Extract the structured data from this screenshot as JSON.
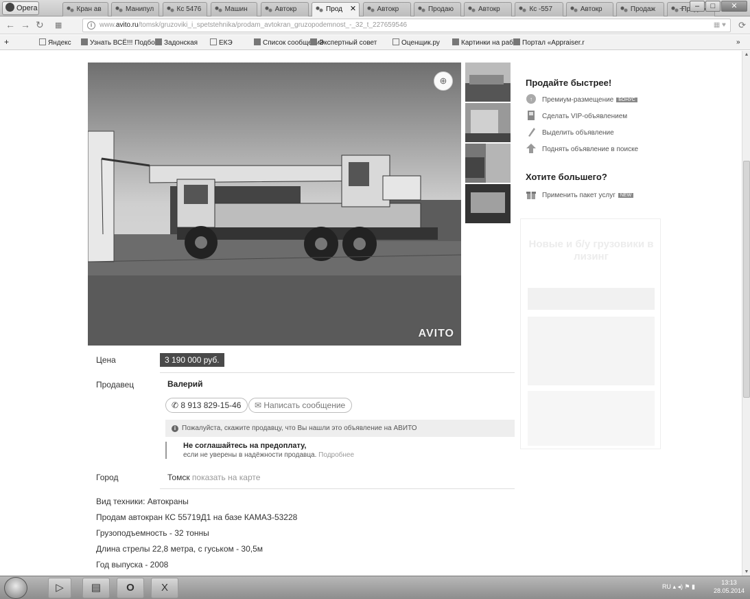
{
  "browser": {
    "menu_label": "Opera",
    "tabs": [
      {
        "label": "Кран ав"
      },
      {
        "label": "Манипул"
      },
      {
        "label": "Кс 5476"
      },
      {
        "label": "Машин"
      },
      {
        "label": "Автокр"
      },
      {
        "label": "Прод",
        "active": true
      },
      {
        "label": "Автокр"
      },
      {
        "label": "Продаю"
      },
      {
        "label": "Автокр"
      },
      {
        "label": "Кс -557"
      },
      {
        "label": "Автокр"
      },
      {
        "label": "Продаж"
      },
      {
        "label": "Продаж"
      }
    ],
    "url_prefix": "www.",
    "url_host": "avito.ru",
    "url_path": "/tomsk/gruzoviki_i_spetstehnika/prodam_avtokran_gruzopodemnost_-_32_t_227659546",
    "bookmarks": [
      "Яндекс",
      "Узнать ВСЁ!!! Подбо",
      "Задонская",
      "ЕКЭ",
      "Список сообщений",
      "Экспертный совет",
      "Оценщик.ру",
      "Картинки на рабоч",
      "Портал «Appraiser.r"
    ],
    "more_bookmarks": "»"
  },
  "listing": {
    "price_label": "Цена",
    "price": "3 190 000 руб.",
    "seller_label": "Продавец",
    "seller_name": "Валерий",
    "phone": "8 913 829-15-46",
    "message_button": "Написать сообщение",
    "notice": "Пожалуйста, скажите продавцу, что Вы нашли это объявление на АВИТО",
    "warning_title": "Не соглашайтесь на предоплату",
    "warning_text": "если не уверены в надёжности продавца.",
    "warning_more": "Подробнее",
    "city_label": "Город",
    "city": "Томск",
    "map_link": "показать на карте",
    "watermark": "AVITO",
    "description": [
      {
        "prefix": "Вид техники: ",
        "value": "Автокраны"
      },
      {
        "prefix": "",
        "value": "Продам автокран КС 55719Д1 на базе КАМАЗ-53228"
      },
      {
        "prefix": "",
        "value": "Грузоподъемность - 32 тонны"
      },
      {
        "prefix": "",
        "value": "Длина стрелы 22,8 метра, с гуськом - 30,5м"
      },
      {
        "prefix": "",
        "value": "Год выпуска - 2008"
      }
    ]
  },
  "sidebar": {
    "sell_faster_title": "Продайте быстрее!",
    "items": [
      {
        "label": "Премиум-размещение",
        "badge": "БОНУС"
      },
      {
        "label": "Сделать VIP-объявлением"
      },
      {
        "label": "Выделить объявление"
      },
      {
        "label": "Поднять объявление в поиске"
      }
    ],
    "want_more_title": "Хотите большего?",
    "package_label": "Применить пакет услуг",
    "package_badge": "NEW",
    "ad_text": "Новые и б/у грузовики в лизинг"
  },
  "taskbar": {
    "lang": "RU",
    "time": "13:13",
    "date": "28.05.2014"
  }
}
